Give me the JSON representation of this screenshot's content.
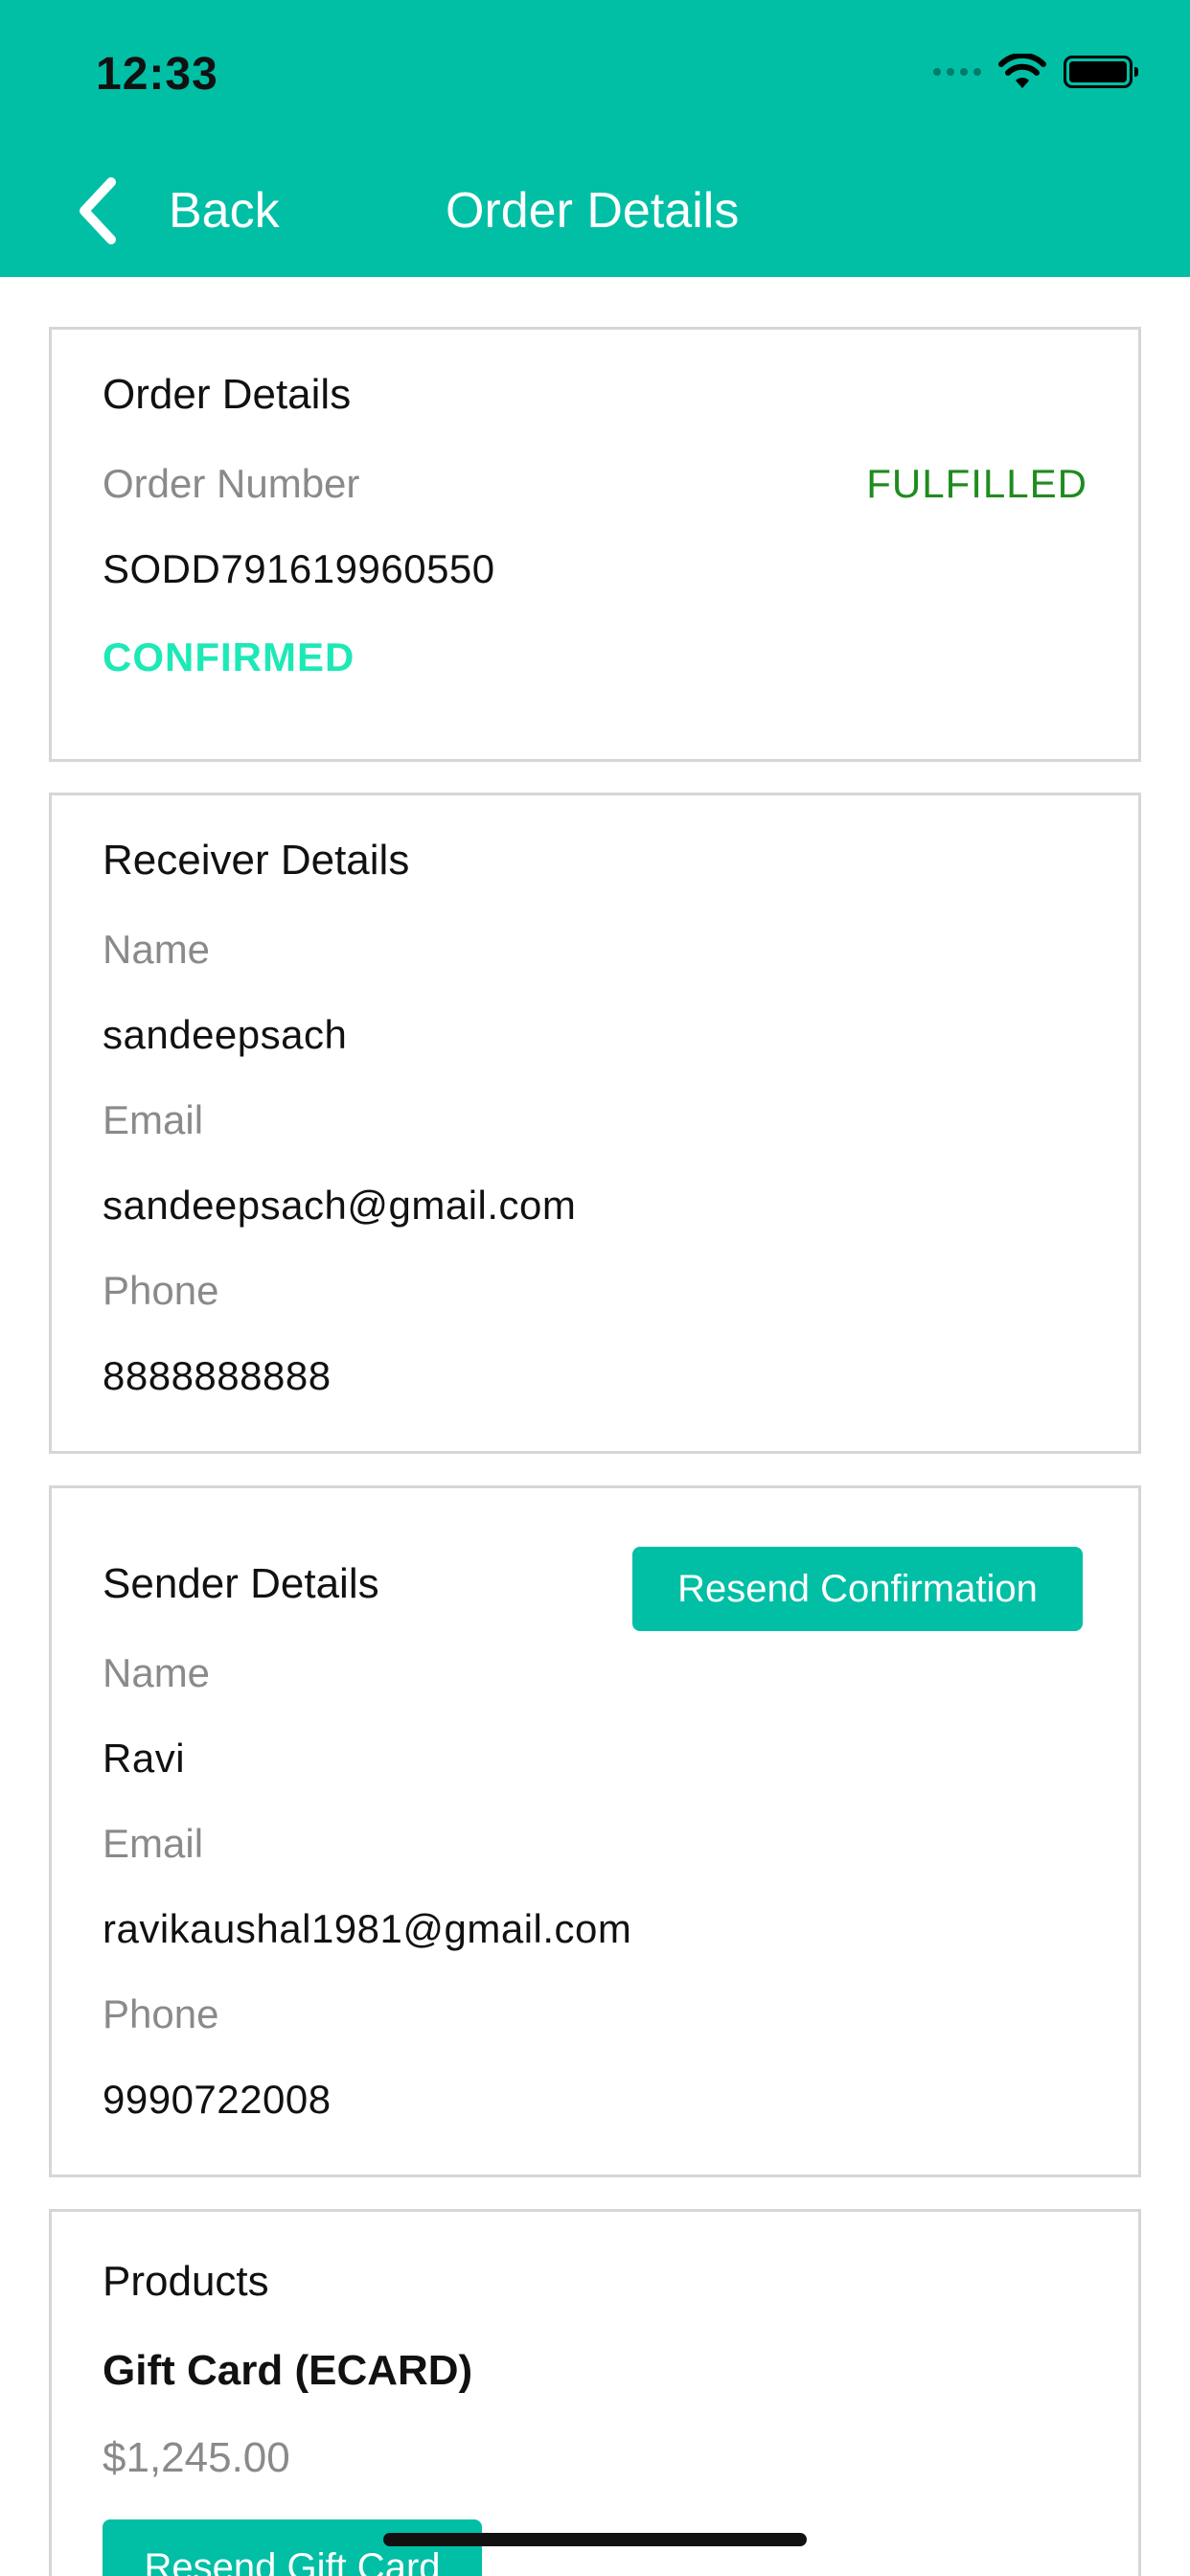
{
  "status_bar": {
    "time": "12:33"
  },
  "nav": {
    "back_label": "Back",
    "title": "Order Details"
  },
  "order_card": {
    "title": "Order Details",
    "order_number_label": "Order Number",
    "fulfillment_status": "FULFILLED",
    "order_number": "SODD791619960550",
    "confirmation_status": "CONFIRMED"
  },
  "receiver_card": {
    "title": "Receiver Details",
    "name_label": "Name",
    "name": "sandeepsach",
    "email_label": "Email",
    "email": "sandeepsach@gmail.com",
    "phone_label": "Phone",
    "phone": "8888888888"
  },
  "sender_card": {
    "title": "Sender Details",
    "resend_button_label": "Resend Confirmation",
    "name_label": "Name",
    "name": "Ravi",
    "email_label": "Email",
    "email": "ravikaushal1981@gmail.com",
    "phone_label": "Phone",
    "phone": "9990722008"
  },
  "products_card": {
    "title": "Products",
    "product_name": "Gift Card (ECARD)",
    "product_price": "$1,245.00",
    "resend_button_label": "Resend Gift Card"
  },
  "colors": {
    "header": "#00BFA5",
    "fulfilled": "#1E8C1E",
    "confirmed": "#1DE9B6",
    "button": "#00BFA5"
  },
  "icons": {
    "back": "chevron-left-icon",
    "signal": "cellular-signal-icon",
    "wifi": "wifi-icon",
    "battery": "battery-icon"
  }
}
